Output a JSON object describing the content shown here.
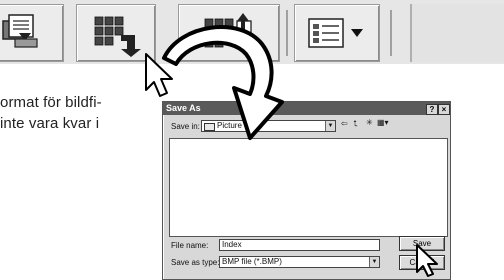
{
  "body_text": {
    "line1": "ormat för bildfi-",
    "line2": "inte vara kvar i"
  },
  "dialog": {
    "title": "Save As",
    "help_btn": "?",
    "close_btn": "×",
    "save_in_label": "Save in:",
    "save_in_value": "Picture",
    "file_name_label": "File name:",
    "file_name_value": "Index",
    "save_as_type_label": "Save as type:",
    "save_as_type_value": "BMP file (*.BMP)",
    "save_button": "Save",
    "cancel_button": "Cancel"
  },
  "icons": {
    "toolbar_btn_1": "print-to-file-icon",
    "toolbar_btn_2": "save-index-icon",
    "toolbar_btn_3": "export-index-icon",
    "toolbar_btn_4": "view-options-dropdown-icon",
    "cursor": "mouse-pointer-icon",
    "arrow": "curved-arrow-icon"
  },
  "colors": {
    "toolbar_bg": "#e6e6e6",
    "dialog_bg": "#d8d8d8",
    "titlebar_bg": "#5a5a5a",
    "arrow_fill": "#ffffff",
    "arrow_stroke": "#000000"
  }
}
